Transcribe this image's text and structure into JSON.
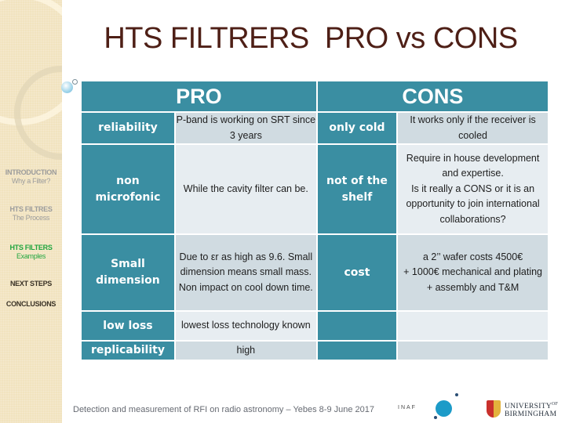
{
  "slide": {
    "title": "HTS FILTRERS  PRO vs CONS",
    "footer": "Detection and measurement of RFI on radio astronomy – Yebes 8-9 June 2017",
    "logos": {
      "inaf": "INAF",
      "university_line1": "UNIVERSITY",
      "university_of": "OF",
      "university_line2": "BIRMINGHAM"
    }
  },
  "sidebar": {
    "items": [
      {
        "title": "INTRODUCTION",
        "subtitle": "Why a Filter?",
        "state": "inactive"
      },
      {
        "title": "HTS FILTRES",
        "subtitle": "The Process",
        "state": "inactive"
      },
      {
        "title": "HTS FILTERS",
        "subtitle": "Examples",
        "state": "active"
      },
      {
        "title": "NEXT STEPS",
        "subtitle": "",
        "state": "upcoming"
      },
      {
        "title": "CONCLUSIONS",
        "subtitle": "",
        "state": "upcoming"
      }
    ]
  },
  "table": {
    "headers": {
      "pro": "PRO",
      "cons": "CONS"
    },
    "rows": [
      {
        "pro_key": "reliability",
        "pro_value": "P-band is working on SRT since 3 years",
        "cons_key": "only cold",
        "cons_value": "It works only if the receiver is cooled"
      },
      {
        "pro_key": "non microfonic",
        "pro_value": "While the cavity filter can be.",
        "cons_key": "not of the shelf",
        "cons_value": "Require in house development and expertise.\nIs it really a CONS or it is an opportunity to join international collaborations?"
      },
      {
        "pro_key": "Small dimension",
        "pro_value": "Due to εr as high as 9.6. Small dimension means small mass. Non impact on cool down time.",
        "cons_key": "cost",
        "cons_value": "a 2’’ wafer costs 4500€\n+ 1000€ mechanical and plating\n+ assembly and T&M"
      },
      {
        "pro_key": "low loss",
        "pro_value": "lowest loss technology known",
        "cons_key": "",
        "cons_value": ""
      },
      {
        "pro_key": "replicability",
        "pro_value": "high",
        "cons_key": "",
        "cons_value": ""
      }
    ]
  },
  "colors": {
    "accent": "#3a8ea2",
    "title": "#4e1f16",
    "active_nav": "#22a640",
    "sidebar_bg": "#f1e3bf"
  }
}
